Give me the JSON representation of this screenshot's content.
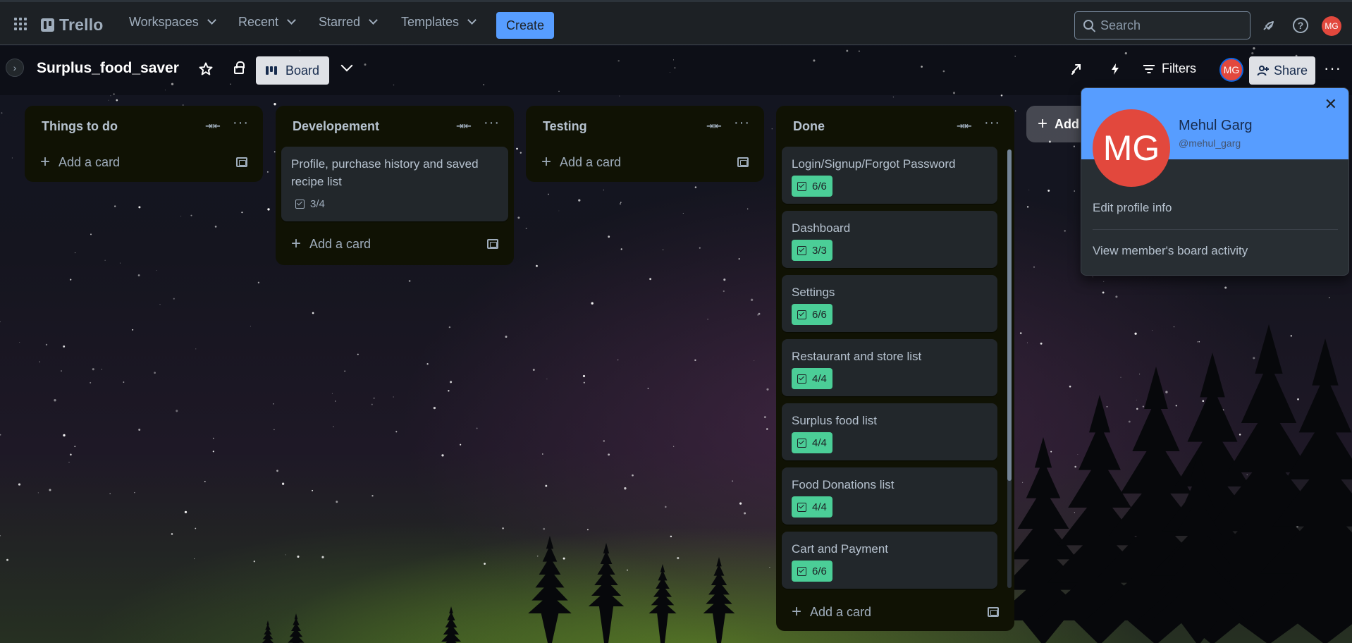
{
  "nav": {
    "logo": "Trello",
    "menus": [
      "Workspaces",
      "Recent",
      "Starred",
      "Templates"
    ],
    "create": "Create",
    "search_placeholder": "Search",
    "avatar_initials": "MG"
  },
  "board": {
    "title": "Surplus_food_saver",
    "view_label": "Board",
    "filters_label": "Filters",
    "share_label": "Share",
    "member_initials": "MG",
    "add_list_label": "Add"
  },
  "lists": [
    {
      "title": "Things to do",
      "cards": [],
      "add_label": "Add a card"
    },
    {
      "title": "Developement",
      "cards": [
        {
          "title": "Profile, purchase history and saved recipe list",
          "checklist": "3/4",
          "complete": false
        }
      ],
      "add_label": "Add a card"
    },
    {
      "title": "Testing",
      "cards": [],
      "add_label": "Add a card"
    },
    {
      "title": "Done",
      "cards": [
        {
          "title": "Login/Signup/Forgot Password",
          "checklist": "6/6",
          "complete": true
        },
        {
          "title": "Dashboard",
          "checklist": "3/3",
          "complete": true
        },
        {
          "title": "Settings",
          "checklist": "6/6",
          "complete": true
        },
        {
          "title": "Restaurant and store list",
          "checklist": "4/4",
          "complete": true
        },
        {
          "title": "Surplus food list",
          "checklist": "4/4",
          "complete": true
        },
        {
          "title": "Food Donations list",
          "checklist": "4/4",
          "complete": true
        },
        {
          "title": "Cart and Payment",
          "checklist": "6/6",
          "complete": true
        }
      ],
      "add_label": "Add a card"
    }
  ],
  "profile_popover": {
    "initials": "MG",
    "name": "Mehul Garg",
    "handle": "@mehul_garg",
    "items": [
      "Edit profile info",
      "View member's board activity"
    ]
  },
  "colors": {
    "accent": "#579dff",
    "avatar": "#e2483d",
    "complete_badge": "#4bce97",
    "list_bg": "#101204",
    "card_bg": "#22272b"
  }
}
